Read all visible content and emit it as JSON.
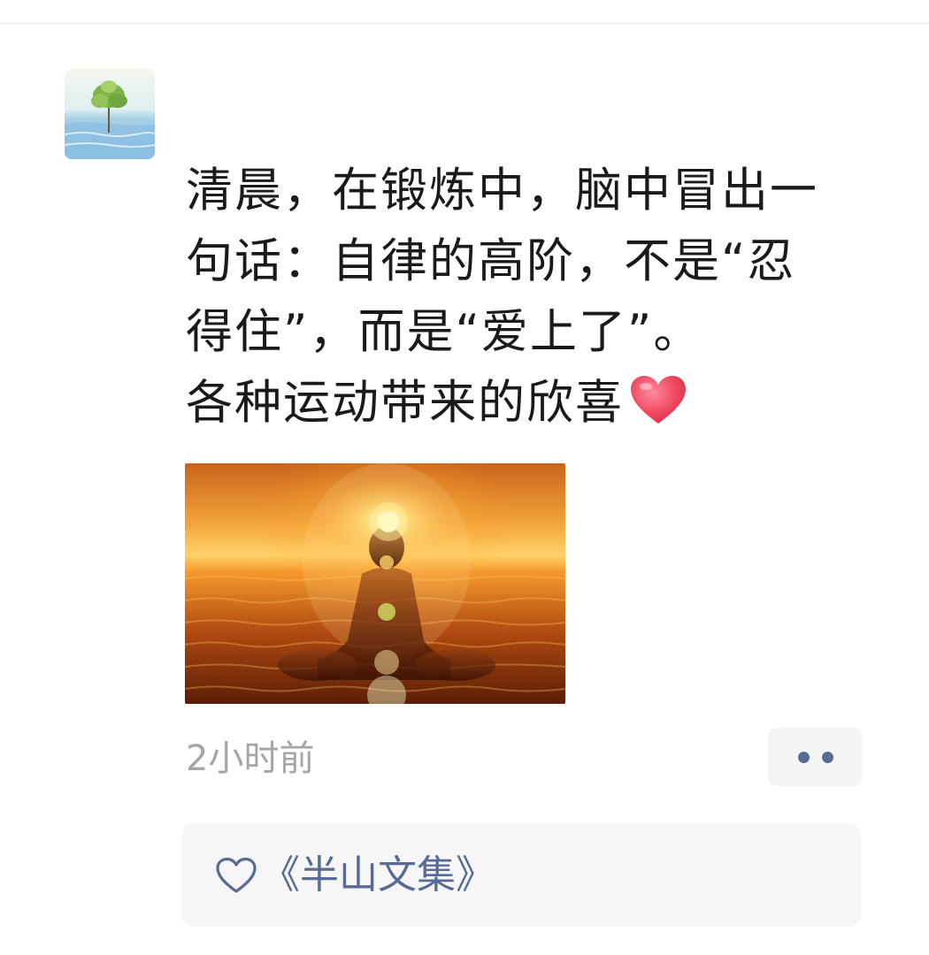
{
  "post": {
    "author_name": "",
    "text_lines": [
      "清晨，在锻炼中，脑中冒出一",
      "句话：自律的高阶，不是“忍",
      "得住”，而是“爱上了”。",
      "各种运动带来的欣喜"
    ],
    "timestamp": "2小时前"
  },
  "likes": {
    "names": "《半山文集》"
  },
  "icons": {
    "avatar": "tree-on-water-avatar",
    "emoji": "red-heart-emoji",
    "more": "two-dots-more-icon",
    "like": "heart-outline-icon"
  },
  "colors": {
    "link": "#576b95",
    "timestamp": "#a6a6a6",
    "panel_bg": "#f6f6f6",
    "heart_emoji": "#ef4760"
  }
}
